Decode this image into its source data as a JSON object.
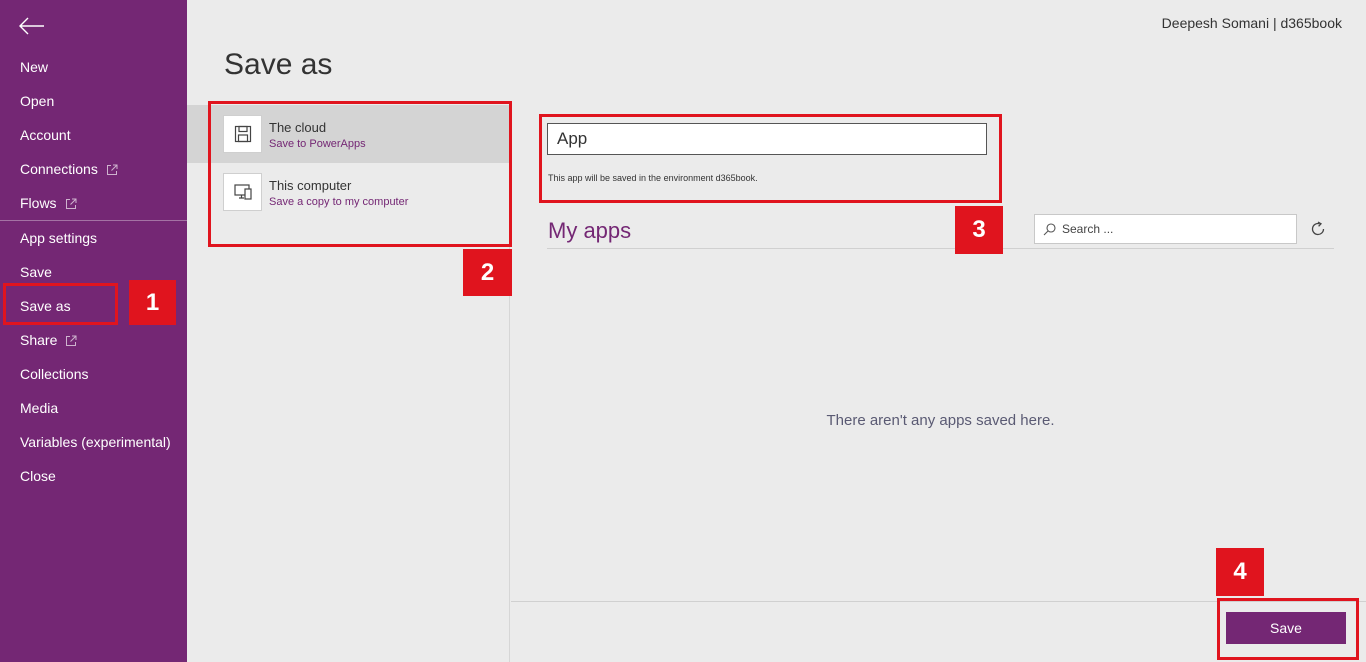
{
  "user": {
    "label": "Deepesh Somani | d365book"
  },
  "sidebar": {
    "back_icon": "back-arrow-icon",
    "items": [
      {
        "label": "New"
      },
      {
        "label": "Open"
      },
      {
        "label": "Account"
      },
      {
        "label": "Connections",
        "external": true
      },
      {
        "label": "Flows",
        "external": true
      },
      {
        "label": "App settings"
      },
      {
        "label": "Save"
      },
      {
        "label": "Save as",
        "active": true
      },
      {
        "label": "Share",
        "external": true
      },
      {
        "label": "Collections"
      },
      {
        "label": "Media"
      },
      {
        "label": "Variables (experimental)"
      },
      {
        "label": "Close"
      }
    ]
  },
  "page": {
    "title": "Save as"
  },
  "locations": [
    {
      "title": "The cloud",
      "subtitle": "Save to PowerApps",
      "icon": "save-disk-icon",
      "selected": true
    },
    {
      "title": "This computer",
      "subtitle": "Save a copy to my computer",
      "icon": "computer-icon",
      "selected": false
    }
  ],
  "form": {
    "app_name_value": "App",
    "environment_note": "This app will be saved in the environment d365book."
  },
  "my_apps": {
    "title": "My apps",
    "search_placeholder": "Search ...",
    "empty_message": "There aren't any apps saved here."
  },
  "actions": {
    "save_label": "Save"
  },
  "annotations": [
    "1",
    "2",
    "3",
    "4"
  ],
  "colors": {
    "accent": "#742774",
    "callout": "#e0141e",
    "background": "#ebebeb"
  }
}
